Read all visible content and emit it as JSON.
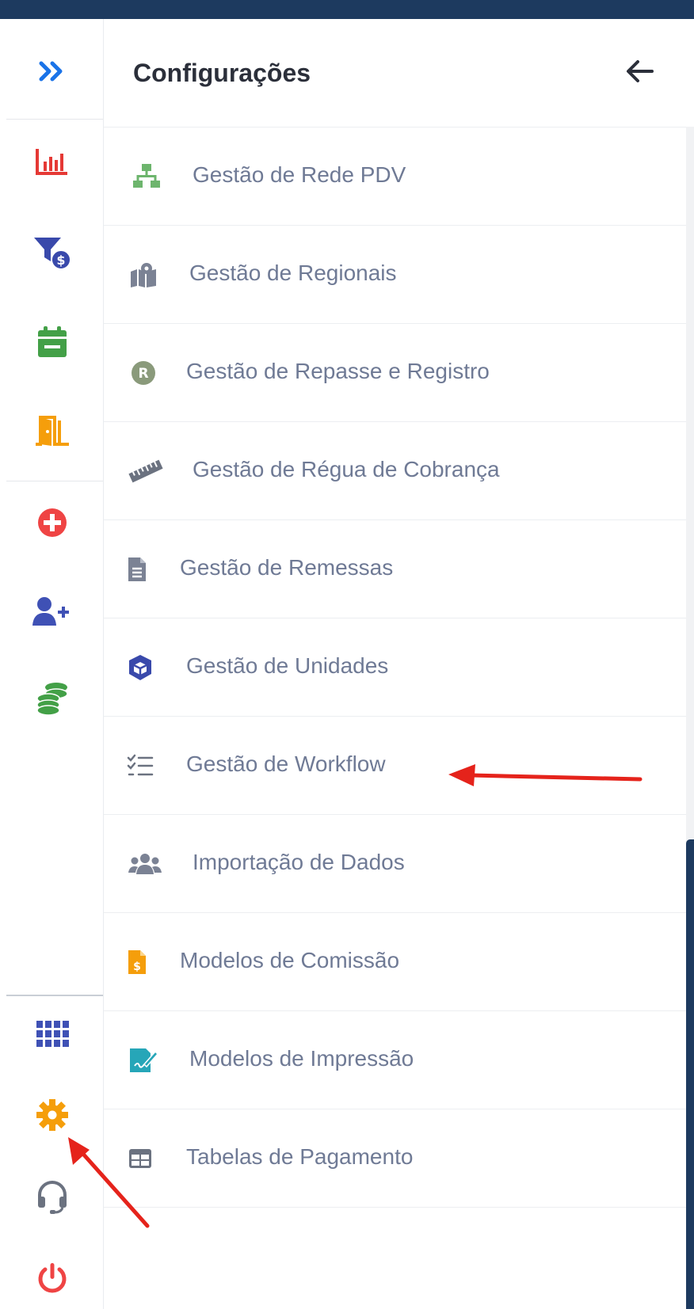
{
  "panel": {
    "title": "Configurações",
    "items": [
      {
        "label": "Gestão de Rede PDV"
      },
      {
        "label": "Gestão de Regionais"
      },
      {
        "label": "Gestão de Repasse e Registro"
      },
      {
        "label": "Gestão de Régua de Cobrança"
      },
      {
        "label": "Gestão de Remessas"
      },
      {
        "label": "Gestão de Unidades"
      },
      {
        "label": "Gestão de Workflow"
      },
      {
        "label": "Importação de Dados"
      },
      {
        "label": "Modelos de Comissão"
      },
      {
        "label": "Modelos de Impressão"
      },
      {
        "label": "Tabelas de Pagamento"
      }
    ]
  },
  "rail": {
    "icons": [
      "expand-icon",
      "chart-icon",
      "filter-money-icon",
      "calendar-icon",
      "door-exit-icon",
      "plus-circle-icon",
      "user-add-icon",
      "coins-icon",
      "apps-grid-icon",
      "gear-icon",
      "headset-icon",
      "power-icon"
    ]
  },
  "colors": {
    "topbar": "#1d3a5f",
    "expand": "#1a73e8",
    "chart": "#e53935",
    "filter": "#3949ab",
    "calendar": "#43a047",
    "door": "#f59e0b",
    "plus": "#ef4444",
    "user": "#3f51b5",
    "coins": "#43a047",
    "grid": "#3f51b5",
    "gear": "#f59e0b",
    "headset": "#6b7280",
    "power": "#ef4444",
    "annotation_arrow": "#e5231b"
  }
}
